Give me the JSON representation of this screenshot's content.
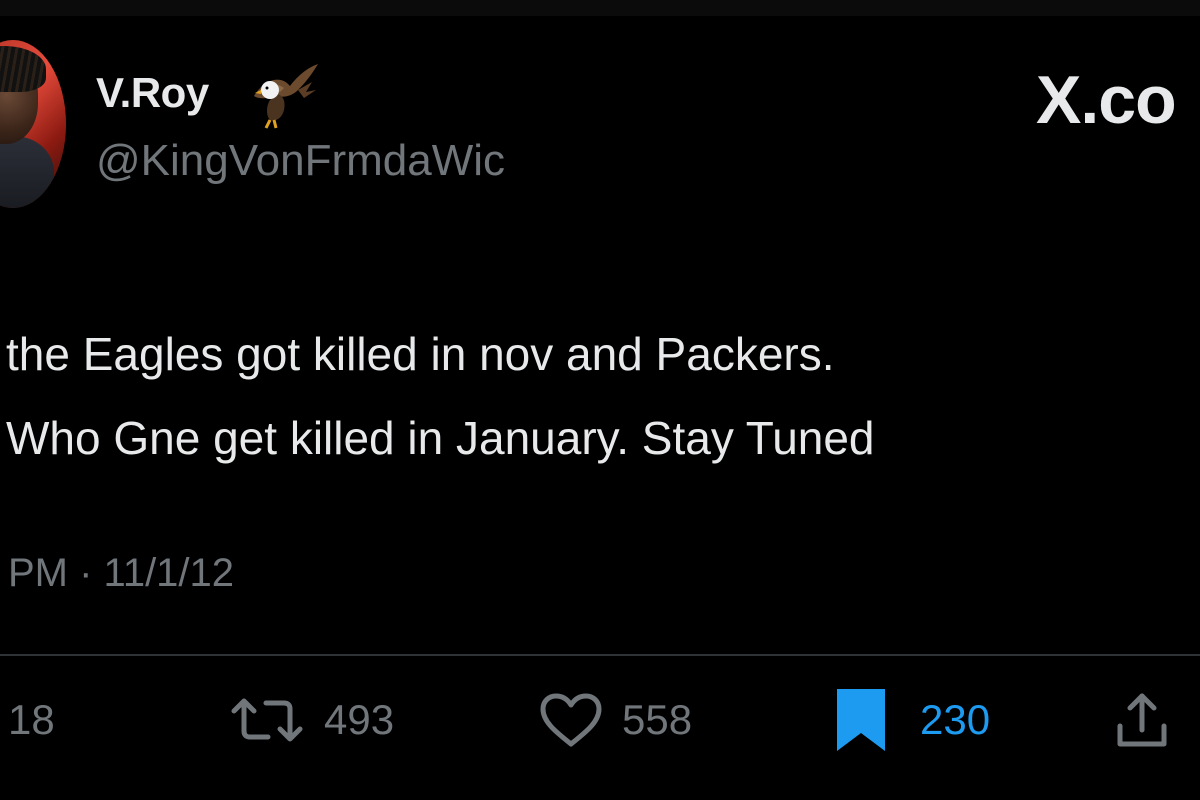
{
  "tweet": {
    "author": {
      "display_name": "V.Roy",
      "display_emoji": "eagle-icon",
      "handle": "@KingVonFrmdaWic"
    },
    "brand_watermark": "X.co",
    "text_lines": [
      "the Eagles got killed in nov and Packers.",
      "Who Gne get killed in January. Stay Tuned"
    ],
    "timestamp": "PM · 11/1/12",
    "actions": {
      "reply_count": "18",
      "retweet_count": "493",
      "like_count": "558",
      "bookmark_count": "230"
    }
  },
  "colors": {
    "background": "#000000",
    "primary_text": "#e7e9ea",
    "secondary_text": "#71767b",
    "accent_blue": "#1d9bf0",
    "divider": "#2f3336"
  }
}
